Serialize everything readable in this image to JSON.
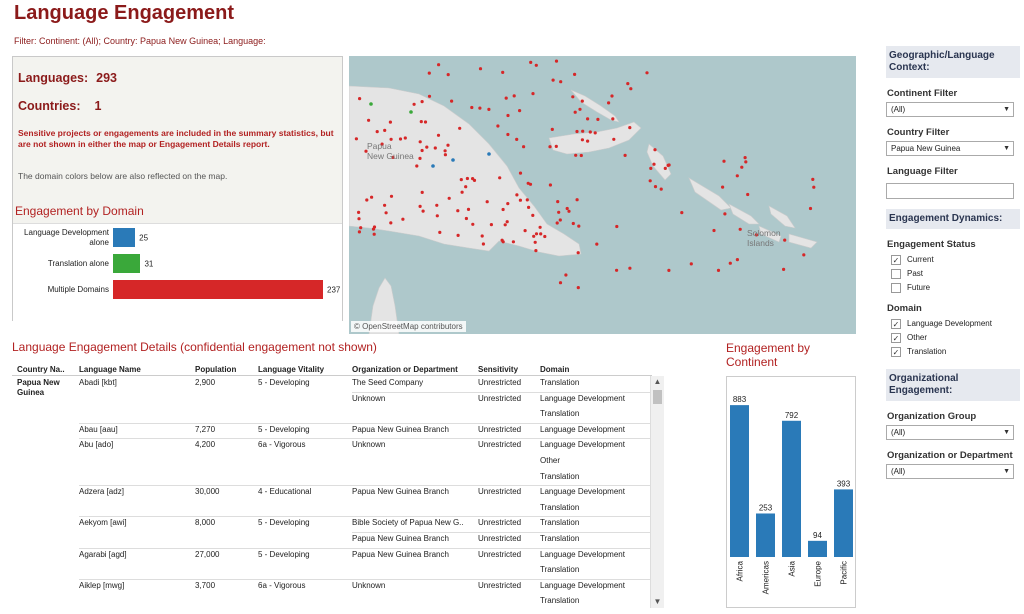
{
  "header": {
    "title": "Language Engagement",
    "filter_text": "Filter:  Continent: (All); Country: Papua New Guinea; Language:"
  },
  "summary": {
    "languages_label": "Languages:",
    "languages_count": "293",
    "countries_label": "Countries:",
    "countries_count": "1",
    "sensitive_note": "Sensitive projects or engagements are included in the summary statistics, but are not  shown in either the map or Engagement Details report.",
    "domain_note": "The domain colors below are also reflected on the map."
  },
  "domain_chart": {
    "title": "Engagement by Domain",
    "max": 237,
    "rows": [
      {
        "label": "Language Development alone",
        "value": 25,
        "color": "#2a7ab8"
      },
      {
        "label": "Translation alone",
        "value": 31,
        "color": "#3aa83a"
      },
      {
        "label": "Multiple Domains",
        "value": 237,
        "color": "#d62728"
      }
    ]
  },
  "map": {
    "credit": "© OpenStreetMap contributors",
    "labels": [
      "Papua",
      "New Guinea",
      "Solomon",
      "Islands"
    ],
    "land_color": "#e4e4e4",
    "water_color": "#aec8cb",
    "dot_color": "#d62728"
  },
  "details": {
    "title": "Language Engagement Details (confidential engagement not shown)",
    "columns": [
      "Country Na..",
      "Language Name",
      "Population",
      "Language Vitality",
      "Organization or Department",
      "Sensitivity",
      "Domain"
    ],
    "country": "Papua New Guinea",
    "rows": [
      {
        "lang": "Abadi [kbt]",
        "pop": "2,900",
        "vit": "5 - Developing",
        "lines": [
          [
            "The Seed Company",
            "Unrestricted",
            "Translation"
          ],
          [
            "Unknown",
            "Unrestricted",
            "Language Development"
          ],
          [
            "",
            "",
            "Translation"
          ]
        ]
      },
      {
        "lang": "Abau [aau]",
        "pop": "7,270",
        "vit": "5 - Developing",
        "lines": [
          [
            "Papua New Guinea Branch",
            "Unrestricted",
            "Language Development"
          ]
        ]
      },
      {
        "lang": "Abu [ado]",
        "pop": "4,200",
        "vit": "6a - Vigorous",
        "lines": [
          [
            "Unknown",
            "Unrestricted",
            "Language Development"
          ],
          [
            "",
            "",
            "Other"
          ],
          [
            "",
            "",
            "Translation"
          ]
        ]
      },
      {
        "lang": "Adzera [adz]",
        "pop": "30,000",
        "vit": "4 - Educational",
        "lines": [
          [
            "Papua New Guinea Branch",
            "Unrestricted",
            "Language Development"
          ],
          [
            "",
            "",
            "Translation"
          ]
        ]
      },
      {
        "lang": "Aekyom [awi]",
        "pop": "8,000",
        "vit": "5 - Developing",
        "lines": [
          [
            "Bible Society of Papua New G..",
            "Unrestricted",
            "Translation"
          ],
          [
            "Papua New Guinea Branch",
            "Unrestricted",
            "Translation"
          ]
        ]
      },
      {
        "lang": "Agarabi [agd]",
        "pop": "27,000",
        "vit": "5 - Developing",
        "lines": [
          [
            "Papua New Guinea Branch",
            "Unrestricted",
            "Language Development"
          ],
          [
            "",
            "",
            "Translation"
          ]
        ]
      },
      {
        "lang": "Aiklep [mwg]",
        "pop": "3,700",
        "vit": "6a - Vigorous",
        "lines": [
          [
            "Unknown",
            "Unrestricted",
            "Language Development"
          ],
          [
            "",
            "",
            "Translation"
          ]
        ]
      }
    ]
  },
  "continent_chart": {
    "title": "Engagement by Continent",
    "categories": [
      "Africa",
      "Americas",
      "Asia",
      "Europe",
      "Pacific"
    ],
    "values": [
      883,
      253,
      792,
      94,
      393
    ],
    "color": "#2a7ab8"
  },
  "sidebar": {
    "geo_heading": "Geographic/Language Context:",
    "continent_label": "Continent Filter",
    "continent_value": "(All)",
    "country_label": "Country Filter",
    "country_value": "Papua New Guinea",
    "language_label": "Language Filter",
    "language_value": "",
    "dynamics_heading": "Engagement Dynamics:",
    "status_label": "Engagement Status",
    "status_options": [
      {
        "label": "Current",
        "checked": true
      },
      {
        "label": "Past",
        "checked": false
      },
      {
        "label": "Future",
        "checked": false
      }
    ],
    "domain_label": "Domain",
    "domain_options": [
      {
        "label": "Language Development",
        "checked": true
      },
      {
        "label": "Other",
        "checked": true
      },
      {
        "label": "Translation",
        "checked": true
      }
    ],
    "org_heading": "Organizational Engagement:",
    "org_group_label": "Organization Group",
    "org_group_value": "(All)",
    "org_dept_label": "Organization or Department",
    "org_dept_value": "(All)"
  },
  "icons": {
    "dropdown": "chevron-down-icon",
    "check": "check-icon",
    "scroll_up": "arrow-up-icon",
    "scroll_down": "arrow-down-icon"
  }
}
